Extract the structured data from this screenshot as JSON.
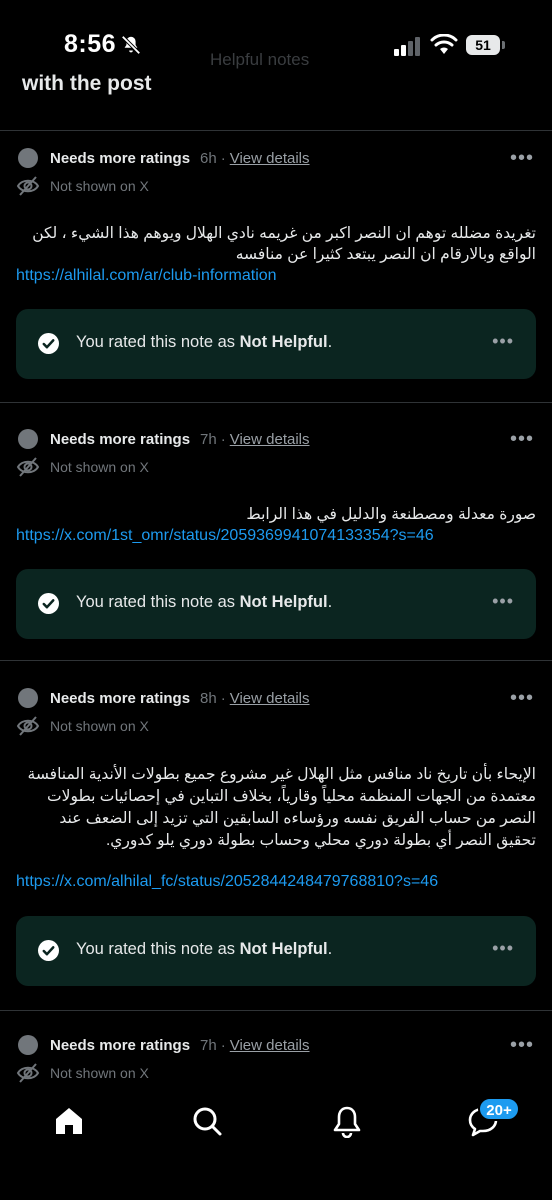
{
  "status_bar": {
    "time": "8:56",
    "battery": "51"
  },
  "header": {
    "faded_text": "Helpful notes",
    "title": "with the post"
  },
  "notes": [
    {
      "status": "Needs more ratings",
      "age": "6h",
      "separator": "·",
      "details": "View details",
      "visibility": "Not shown on X",
      "text": "تغريدة مضلله توهم ان النصر اكبر من غريمه نادي الهلال ويوهم هذا الشيء ، لكن الواقع وبالارقام ان النصر يبتعد كثيرا عن منافسه",
      "link": "https://alhilal.com/ar/club-information",
      "rated_prefix": "You rated this note as ",
      "rated_value": "Not Helpful",
      "rated_suffix": "."
    },
    {
      "status": "Needs more ratings",
      "age": "7h",
      "separator": "·",
      "details": "View details",
      "visibility": "Not shown on X",
      "text": "صورة معدلة ومصطنعة والدليل في هذا الرابط",
      "link": "https://x.com/1st_omr/status/2059369941074133354?s=46",
      "rated_prefix": "You rated this note as ",
      "rated_value": "Not Helpful",
      "rated_suffix": "."
    },
    {
      "status": "Needs more ratings",
      "age": "8h",
      "separator": "·",
      "details": "View details",
      "visibility": "Not shown on X",
      "text": "الإيحاء بأن تاريخ ناد منافس مثل الهلال غير مشروع جميع بطولات الأندية المنافسة معتمدة من الجهات المنظمة محلياً وقارياً، بخلاف التباين في إحصائيات بطولات النصر من حساب الفريق نفسه ورؤساءه السابقين التي تزيد إلى الضعف عند تحقيق النصر أي بطولة دوري محلي وحساب بطولة دوري يلو كدوري.",
      "link": "https://x.com/alhilal_fc/status/2052844248479768810?s=46",
      "rated_prefix": "You rated this note as ",
      "rated_value": "Not Helpful",
      "rated_suffix": "."
    },
    {
      "status": "Needs more ratings",
      "age": "7h",
      "separator": "·",
      "details": "View details",
      "visibility": "Not shown on X"
    }
  ],
  "nav": {
    "items": [
      "home-icon",
      "search-icon",
      "notifications-icon",
      "messages-icon"
    ],
    "messages_badge": "20+"
  },
  "colors": {
    "accent": "#1d9bf0",
    "rated_box": "#0b2520",
    "muted": "#71767b"
  }
}
